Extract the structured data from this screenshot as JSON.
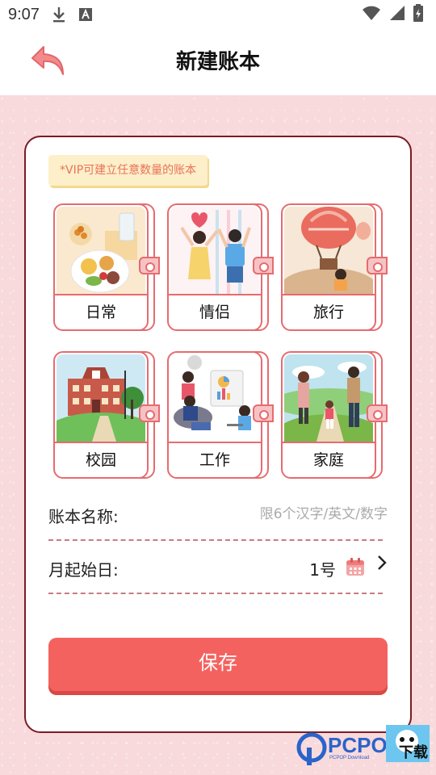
{
  "status": {
    "time": "9:07"
  },
  "header": {
    "title": "新建账本"
  },
  "vip_note": "*VIP可建立任意数量的账本",
  "categories": [
    {
      "label": "日常"
    },
    {
      "label": "情侣"
    },
    {
      "label": "旅行"
    },
    {
      "label": "校园"
    },
    {
      "label": "工作"
    },
    {
      "label": "家庭"
    }
  ],
  "form": {
    "name_label": "账本名称:",
    "name_placeholder": "限6个汉字/英文/数字",
    "start_day_label": "月起始日:",
    "start_day_value": "1号"
  },
  "save_label": "保存",
  "watermark": {
    "brand": "PCPOP",
    "sub": "PCPOP Download",
    "tag": "下载"
  },
  "colors": {
    "accent": "#f4625f",
    "border": "#e66b6f",
    "background": "#f8d9dc"
  }
}
